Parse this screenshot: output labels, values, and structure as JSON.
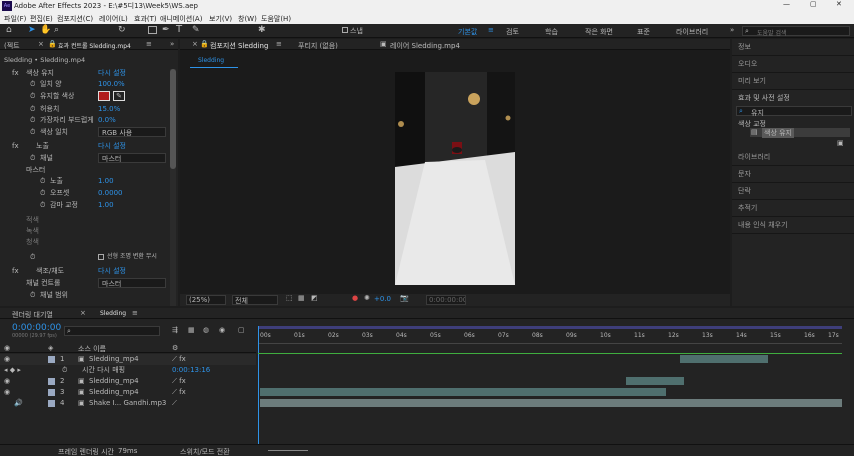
{
  "window": {
    "app_icon": "Ae",
    "title": "Adobe After Effects 2023 - E:\\#5디13\\Week5\\WS.aep"
  },
  "menu": [
    "파일(F)",
    "편집(E)",
    "컴포지션(C)",
    "레이어(L)",
    "효과(T)",
    "애니메이션(A)",
    "보기(V)",
    "창(W)",
    "도움말(H)"
  ],
  "toolbar": {
    "snap_label": "스냅",
    "workspaces": [
      "기본값",
      "검토",
      "학습",
      "작은 화면",
      "표준",
      "라이브러리"
    ],
    "active_workspace": "기본값",
    "search_placeholder": "도움말 검색"
  },
  "effects_panel": {
    "tab_proj": "(젝트",
    "tab_label": "효과 컨트롤 Sledding.mp4",
    "layer_path": "Sledding • Sledding.mp4",
    "rows": [
      {
        "label": "색상 유지",
        "value": "다시 설정"
      },
      {
        "label": "일치 양",
        "value": "100.0%"
      },
      {
        "label": "유지할 색상",
        "value": ""
      },
      {
        "label": "허용치",
        "value": "15.0%"
      },
      {
        "label": "가장자리 부드럽게",
        "value": "0.0%"
      },
      {
        "label": "색상 일치",
        "value": "RGB 사용"
      },
      {
        "label": "노출",
        "value": "다시 설정"
      },
      {
        "label": "채널",
        "value": "마스터"
      },
      {
        "label": "마스터",
        "value": ""
      },
      {
        "label": "노출",
        "value": "1.00"
      },
      {
        "label": "오프셋",
        "value": "0.0000"
      },
      {
        "label": "감마 교정",
        "value": "1.00"
      },
      {
        "label": "적색",
        "value": ""
      },
      {
        "label": "녹색",
        "value": ""
      },
      {
        "label": "청색",
        "value": ""
      },
      {
        "label": "선형 조명 변환 무시",
        "value": ""
      },
      {
        "label": "색조/채도",
        "value": "다시 설정"
      },
      {
        "label": "채널 컨트롤",
        "value": "마스터"
      },
      {
        "label": "채널 범위",
        "value": ""
      }
    ]
  },
  "comp_panel": {
    "tab_label": "컴포지션 Sledding",
    "tab_footage": "푸티지 (없음)",
    "tab_layer": "레이어 Sledding.mp4",
    "sub_tab": "Sledding",
    "zoom": "(25%)",
    "resolution": "전체",
    "plus": "+0.0",
    "time": "0:00:00:00"
  },
  "right_panel": {
    "items": [
      "정보",
      "오디오",
      "미리 보기"
    ],
    "effects_title": "효과 및 사전 설정",
    "search_value": "유지",
    "tree_parent": "색상 교정",
    "tree_child": "색상 유지",
    "items2": [
      "라이브러리",
      "문자",
      "단락",
      "추적기",
      "내용 인식 채우기"
    ]
  },
  "timeline": {
    "render_tab": "렌더링 대기열",
    "comp_tab": "Sledding",
    "time": "0:00:00:00",
    "fps": "00000 (29.97 fps)",
    "col_source": "소스 이름",
    "ruler": [
      "00s",
      "01s",
      "02s",
      "03s",
      "04s",
      "05s",
      "06s",
      "07s",
      "08s",
      "09s",
      "10s",
      "11s",
      "12s",
      "13s",
      "14s",
      "15s",
      "16s",
      "17s"
    ],
    "layers": [
      {
        "num": "1",
        "name": "Sledding_mp4"
      },
      {
        "num": "",
        "name": "시간 다시 매핑",
        "value": "0:00:13:16"
      },
      {
        "num": "2",
        "name": "Sledding_mp4"
      },
      {
        "num": "3",
        "name": "Sledding_mp4"
      },
      {
        "num": "4",
        "name": "Shake I... Gandhi.mp3"
      }
    ],
    "footer_frame_label": "프레임 렌더링 시간",
    "footer_frame_value": "79ms",
    "footer_mode": "스위치/모드 전환"
  },
  "colors": {
    "accent": "#2e93e8",
    "keep_color": "#b01c1c",
    "bar": "#4f6f6e"
  }
}
